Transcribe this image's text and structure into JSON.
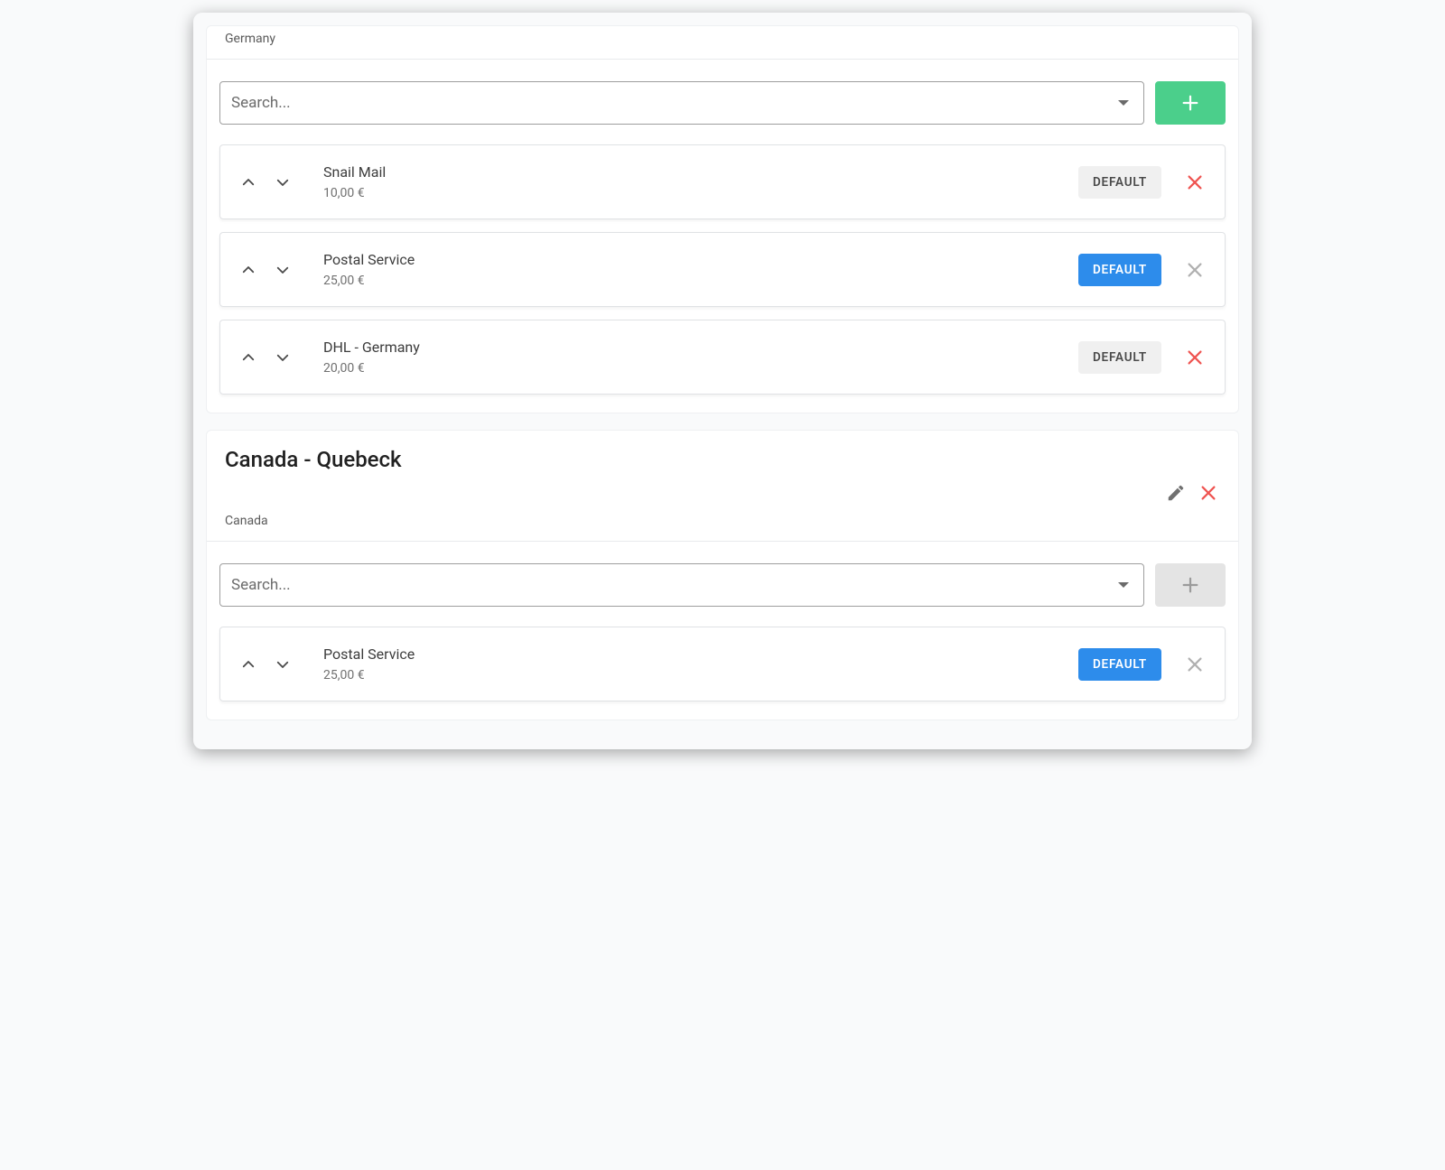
{
  "search_placeholder": "Search...",
  "default_label": "DEFAULT",
  "zones": [
    {
      "country": "Germany",
      "title": null,
      "add_enabled": true,
      "methods": [
        {
          "name": "Snail Mail",
          "price": "10,00 €",
          "is_default": false,
          "removable": true
        },
        {
          "name": "Postal Service",
          "price": "25,00 €",
          "is_default": true,
          "removable": false
        },
        {
          "name": "DHL - Germany",
          "price": "20,00 €",
          "is_default": false,
          "removable": true
        }
      ]
    },
    {
      "country": "Canada",
      "title": "Canada - Quebeck",
      "add_enabled": false,
      "methods": [
        {
          "name": "Postal Service",
          "price": "25,00 €",
          "is_default": true,
          "removable": false
        }
      ]
    }
  ]
}
